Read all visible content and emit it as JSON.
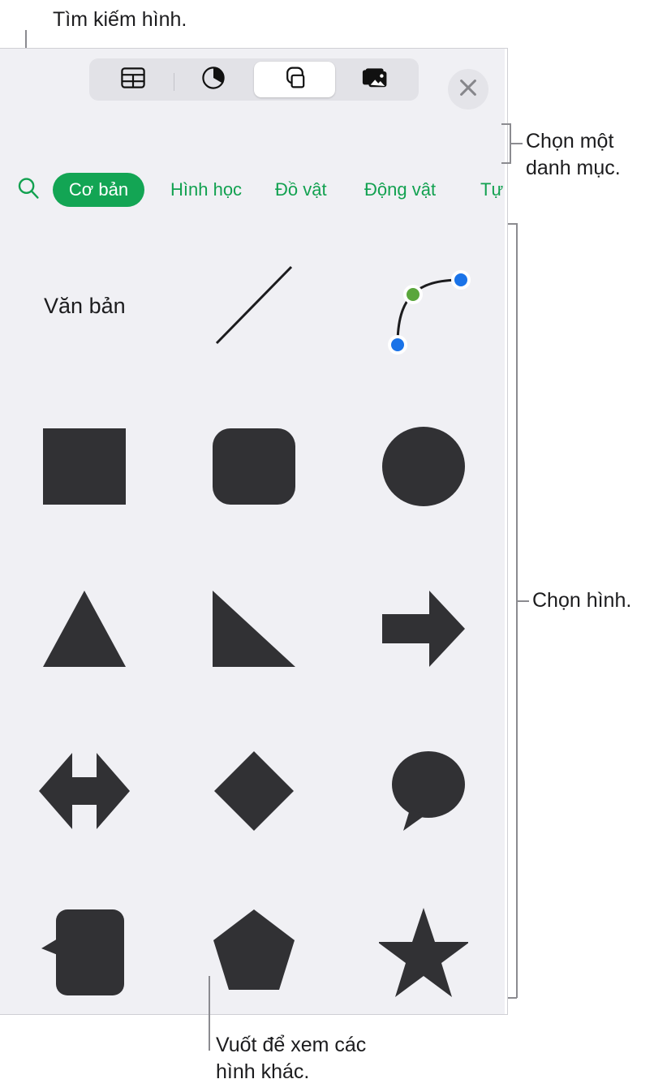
{
  "app": {
    "panel_title": "Shapes browser",
    "background_color": "#f0f0f4",
    "accent_color": "#13a554",
    "shape_fill_color": "#313134"
  },
  "toolbar": {
    "items": [
      {
        "icon": "table-icon",
        "label": "Table",
        "active": false
      },
      {
        "icon": "chart-icon",
        "label": "Chart",
        "active": false
      },
      {
        "icon": "shapes-icon",
        "label": "Shape",
        "active": true
      },
      {
        "icon": "media-icon",
        "label": "Media",
        "active": false
      }
    ],
    "close_label": "Close",
    "close_icon": "close-icon"
  },
  "categories": {
    "search_icon": "search-icon",
    "tabs": [
      {
        "label": "Cơ bản",
        "active": true
      },
      {
        "label": "Hình học",
        "active": false
      },
      {
        "label": "Đồ vật",
        "active": false
      },
      {
        "label": "Động vật",
        "active": false
      },
      {
        "label": "Tự",
        "active": false
      }
    ]
  },
  "shapes": {
    "rows": [
      [
        {
          "name": "text-shape",
          "label": "Văn bản",
          "kind": "text"
        },
        {
          "name": "line-shape",
          "label": "Line",
          "kind": "line"
        },
        {
          "name": "curve-shape",
          "label": "Curve",
          "kind": "curve"
        }
      ],
      [
        {
          "name": "rectangle-shape",
          "label": "Rectangle",
          "kind": "rectangle"
        },
        {
          "name": "rounded-rectangle-shape",
          "label": "Rounded Rectangle",
          "kind": "rounded-rectangle"
        },
        {
          "name": "ellipse-shape",
          "label": "Ellipse",
          "kind": "ellipse"
        }
      ],
      [
        {
          "name": "triangle-shape",
          "label": "Triangle",
          "kind": "triangle"
        },
        {
          "name": "right-triangle-shape",
          "label": "Right Triangle",
          "kind": "right-triangle"
        },
        {
          "name": "right-arrow-shape",
          "label": "Right Arrow",
          "kind": "right-arrow"
        }
      ],
      [
        {
          "name": "double-arrow-shape",
          "label": "Double Arrow",
          "kind": "double-arrow"
        },
        {
          "name": "diamond-shape",
          "label": "Diamond",
          "kind": "diamond"
        },
        {
          "name": "speech-bubble-shape",
          "label": "Speech Bubble",
          "kind": "speech-bubble"
        }
      ],
      [
        {
          "name": "rounded-callout-shape",
          "label": "Rounded Callout",
          "kind": "rounded-callout"
        },
        {
          "name": "pentagon-shape",
          "label": "Pentagon",
          "kind": "pentagon"
        },
        {
          "name": "star-shape",
          "label": "Star",
          "kind": "star"
        }
      ]
    ],
    "curve_handles": {
      "start_color": "#1a73e8",
      "end_color": "#1a73e8",
      "control_color": "#5aa63c"
    }
  },
  "annotations": [
    {
      "name": "annotation-search",
      "text": "Tìm kiếm hình."
    },
    {
      "name": "annotation-category",
      "text": "Chọn một\ndanh mục."
    },
    {
      "name": "annotation-shape",
      "text": "Chọn hình."
    },
    {
      "name": "annotation-swipe",
      "text": "Vuốt để xem các\nhình khác."
    }
  ]
}
